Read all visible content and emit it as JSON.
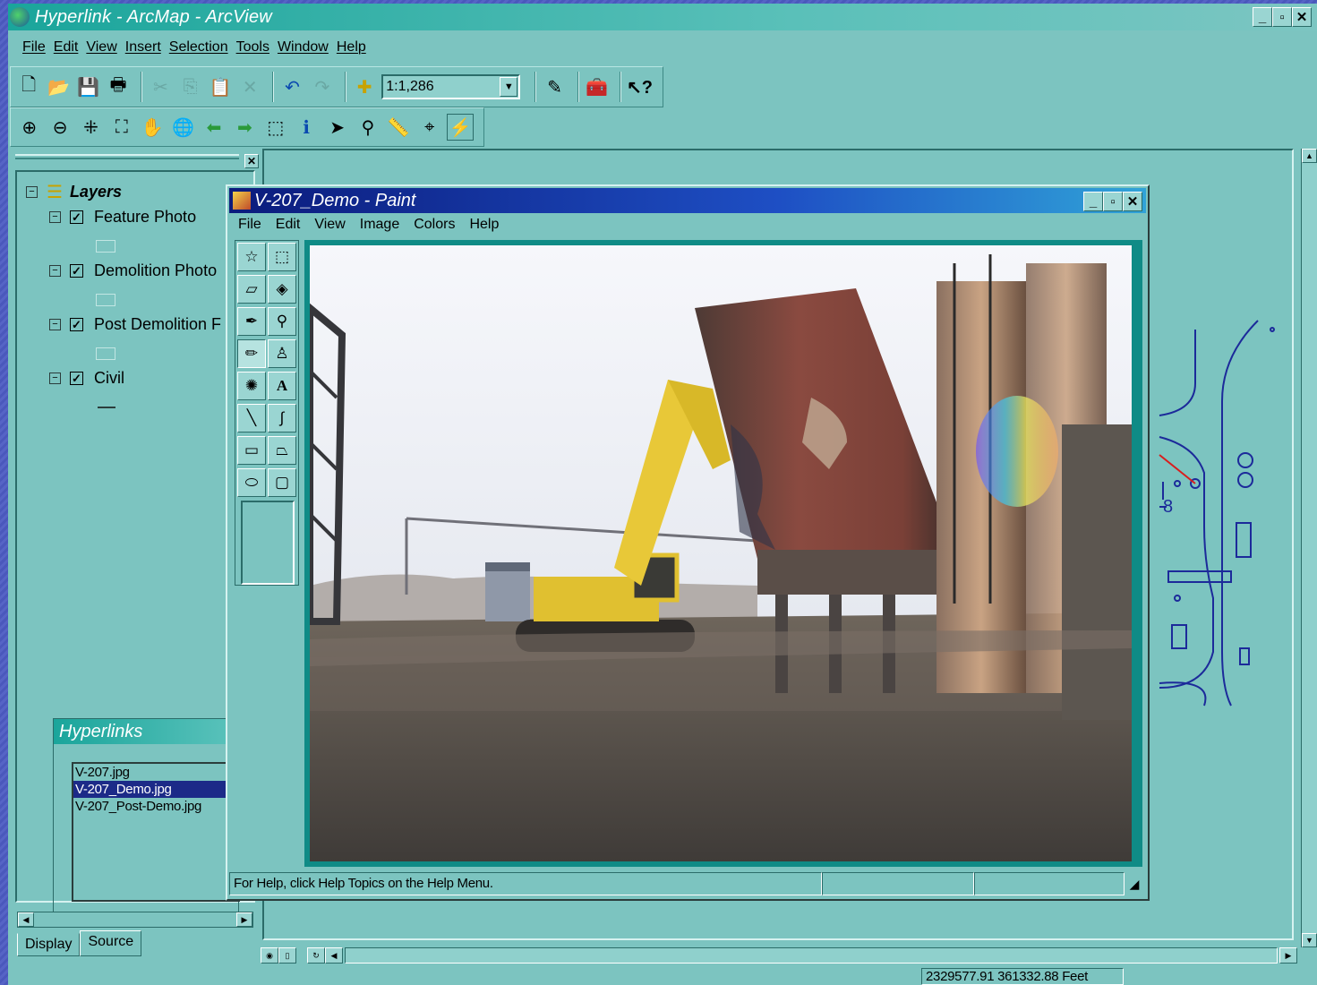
{
  "app": {
    "title": "Hyperlink - ArcMap - ArcView",
    "window_buttons": [
      "_",
      "▫",
      "✕"
    ]
  },
  "menu": [
    "File",
    "Edit",
    "View",
    "Insert",
    "Selection",
    "Tools",
    "Window",
    "Help"
  ],
  "toolbar": {
    "scale": "1:1,286"
  },
  "toc": {
    "root": "Layers",
    "layers": [
      {
        "label": "Feature Photo",
        "checked": true
      },
      {
        "label": "Demolition Photo",
        "checked": true
      },
      {
        "label": "Post Demolition F",
        "checked": true
      },
      {
        "label": "Civil",
        "checked": true
      }
    ],
    "tabs": [
      "Display",
      "Source"
    ]
  },
  "hyperlinks": {
    "title": "Hyperlinks",
    "items": [
      "V-207.jpg",
      "V-207_Demo.jpg",
      "V-207_Post-Demo.jpg"
    ],
    "selected_index": 1
  },
  "paint": {
    "title": "V-207_Demo - Paint",
    "menu": [
      "File",
      "Edit",
      "View",
      "Image",
      "Colors",
      "Help"
    ],
    "status": "For Help, click Help Topics on the Help Menu."
  },
  "status_bar": {
    "coordinates": "2329577.91  361332.88 Feet"
  },
  "colors": {
    "app_bg": "#7cc4c0",
    "titlebar": "#1aa59b",
    "paint_titlebar": "#0b1b7c",
    "selection": "#1c2a88"
  }
}
